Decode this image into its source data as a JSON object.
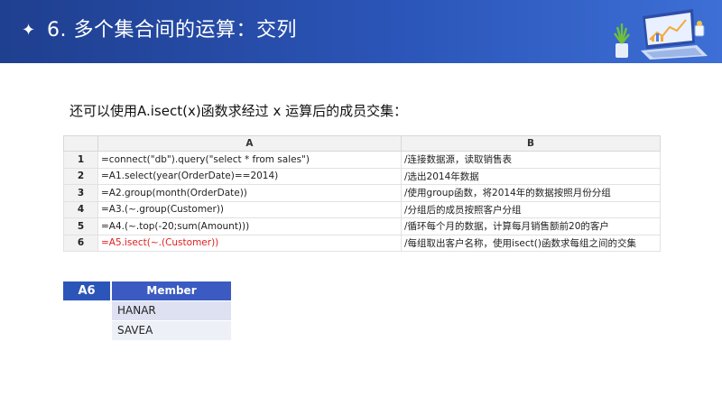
{
  "header": {
    "bullet": "✦",
    "title": "6. 多个集合间的运算：交列"
  },
  "intro": "还可以使用A.isect(x)函数求经过 x 运算后的成员交集：",
  "grid": {
    "columns": [
      "A",
      "B"
    ],
    "rows": [
      {
        "num": "1",
        "a": "=connect(\"db\").query(\"select * from sales\")",
        "b": "/连接数据源，读取销售表"
      },
      {
        "num": "2",
        "a": "=A1.select(year(OrderDate)==2014)",
        "b": "/选出2014年数据"
      },
      {
        "num": "3",
        "a": "=A2.group(month(OrderDate))",
        "b": "/使用group函数，将2014年的数据按照月份分组"
      },
      {
        "num": "4",
        "a": "=A3.(~.group(Customer))",
        "b": "/分组后的成员按照客户分组"
      },
      {
        "num": "5",
        "a": "=A4.(~.top(-20;sum(Amount)))",
        "b": "/循环每个月的数据，计算每月销售额前20的客户"
      },
      {
        "num": "6",
        "a": "=A5.isect(~.(Customer))",
        "b": "/每组取出客户名称，使用isect()函数求每组之间的交集"
      }
    ],
    "highlight_color": "#e02020"
  },
  "result": {
    "label": "A6",
    "column": "Member",
    "values": [
      "HANAR",
      "SAVEA"
    ]
  },
  "colors": {
    "header_bg": "#2b55b8",
    "label_bg": "#2b55b8"
  }
}
